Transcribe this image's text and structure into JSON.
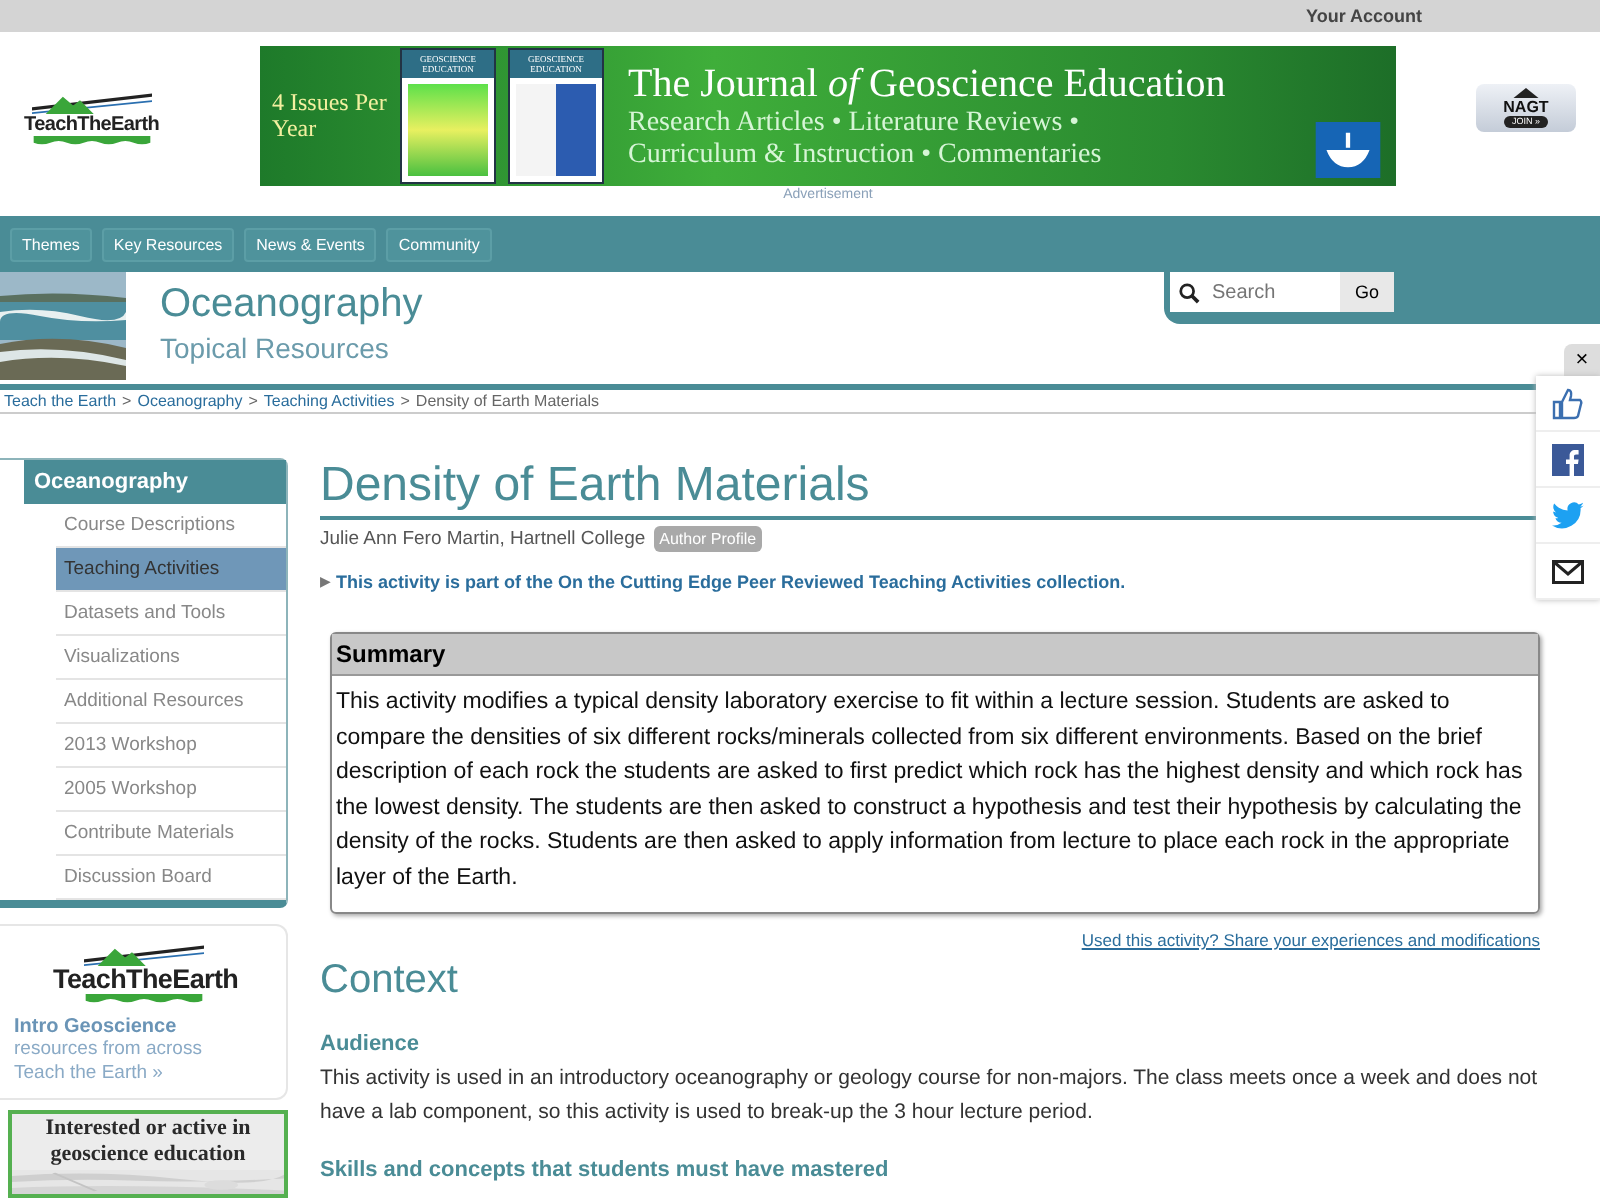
{
  "top_bar": {
    "account_link": "Your Account"
  },
  "header": {
    "logo": "TeachTheEarth",
    "ad": {
      "issues": "4 Issues Per Year",
      "cover_titles": [
        "GEOSCIENCE EDUCATION",
        "GEOSCIENCE EDUCATION"
      ],
      "title_before": "The Journal ",
      "title_em": "of",
      "title_after": " Geoscience Education",
      "line_1": "Research Articles • Literature Reviews •",
      "line_2": "Curriculum & Instruction • Commentaries"
    },
    "ad_label": "Advertisement",
    "nagt": {
      "name": "NAGT",
      "join": "JOIN »"
    }
  },
  "nav": {
    "items": [
      {
        "label": "Themes"
      },
      {
        "label": "Key Resources"
      },
      {
        "label": "News & Events"
      },
      {
        "label": "Community"
      }
    ]
  },
  "section": {
    "title": "Oceanography",
    "subtitle": "Topical Resources",
    "search": {
      "placeholder": "Search",
      "button": "Go"
    }
  },
  "breadcrumb": {
    "links": [
      "Teach the Earth",
      "Oceanography",
      "Teaching Activities"
    ],
    "separator": ">",
    "current": "Density of Earth Materials"
  },
  "sidebar": {
    "title": "Oceanography",
    "items": [
      {
        "label": "Course Descriptions",
        "selected": false
      },
      {
        "label": "Teaching Activities",
        "selected": true
      },
      {
        "label": "Datasets and Tools",
        "selected": false
      },
      {
        "label": "Visualizations",
        "selected": false
      },
      {
        "label": "Additional Resources",
        "selected": false
      },
      {
        "label": "2013 Workshop",
        "selected": false
      },
      {
        "label": "2005 Workshop",
        "selected": false
      },
      {
        "label": "Contribute Materials",
        "selected": false
      },
      {
        "label": "Discussion Board",
        "selected": false
      }
    ],
    "promo": {
      "logo": "TeachTheEarth",
      "title": "Intro Geoscience",
      "text": "resources from across Teach the Earth »"
    },
    "ad": {
      "text": "Interested or active in geoscience education"
    }
  },
  "article": {
    "title": "Density of Earth Materials",
    "author": "Julie Ann Fero Martin, Hartnell College",
    "author_badge": "Author Profile",
    "collection_marker": "▶",
    "collection_note": "This activity is part of the On the Cutting Edge Peer Reviewed Teaching Activities collection.",
    "summary": {
      "heading": "Summary",
      "text": "This activity modifies a typical density laboratory exercise to fit within a lecture session. Students are asked to compare the densities of six different rocks/minerals collected from six different environments. Based on the brief description of each rock the students are asked to first predict which rock has the highest density and which rock has the lowest density. The students are then asked to construct a hypothesis and test their hypothesis by calculating the density of the rocks. Students are then asked to apply information from lecture to place each rock in the appropriate layer of the Earth."
    },
    "share_link": "Used this activity? Share your experiences and modifications",
    "context_heading": "Context",
    "subsections": [
      {
        "heading": "Audience",
        "text": "This activity is used in an introductory oceanography or geology course for non-majors. The class meets once a week and does not have a lab component, so this activity is used to break-up the 3 hour lecture period."
      },
      {
        "heading": "Skills and concepts that students must have mastered"
      }
    ]
  },
  "share_bar": {
    "close": "×",
    "buttons": [
      {
        "kind": "like"
      },
      {
        "kind": "facebook"
      },
      {
        "kind": "twitter"
      },
      {
        "kind": "email"
      }
    ]
  }
}
